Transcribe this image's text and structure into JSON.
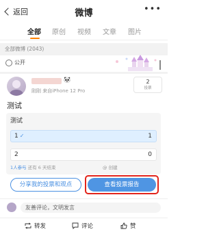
{
  "header": {
    "back_label": "返回",
    "title": "微博",
    "more": "•••"
  },
  "tabs": [
    {
      "label": "全部",
      "active": true
    },
    {
      "label": "原创",
      "active": false
    },
    {
      "label": "视频",
      "active": false
    },
    {
      "label": "文章",
      "active": false
    },
    {
      "label": "图片",
      "active": false
    }
  ],
  "count_bar": "全部微博 (2043)",
  "visibility": "公开",
  "post": {
    "meta": "刚刚  来自iPhone 12 Pro",
    "badge_count": "2",
    "badge_label": "投票",
    "text": "测试"
  },
  "poll": {
    "title": "测试",
    "options": [
      {
        "label": "1",
        "count": "1",
        "selected": true
      },
      {
        "label": "2",
        "count": "0",
        "selected": false
      }
    ],
    "participants": "1人参与",
    "ends": "还有 6 天结束",
    "creator": "@  创建"
  },
  "buttons": {
    "share": "分享我的投票和观点",
    "report": "查看投票报告"
  },
  "comment": {
    "placeholder": "友善评论，文明发言"
  },
  "actions": {
    "repost": "转发",
    "comment": "评论",
    "like": "赞"
  },
  "colors": {
    "accent": "#ff8200",
    "link_blue": "#4a90e2",
    "button_blue": "#4f95e3",
    "highlight_red": "#e2231a"
  }
}
